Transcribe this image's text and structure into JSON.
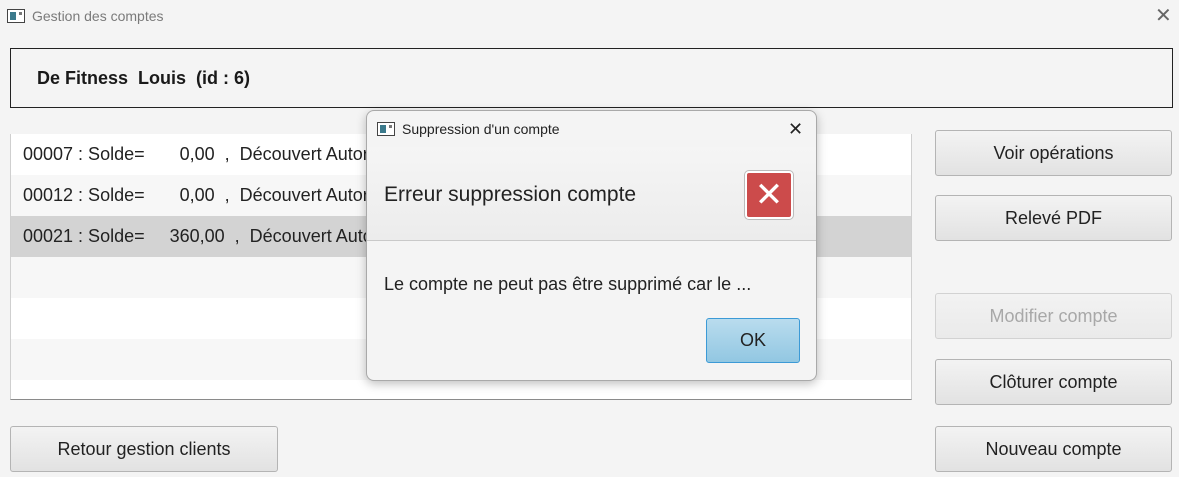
{
  "window": {
    "title": "Gestion des comptes",
    "close_glyph": "✕"
  },
  "client": {
    "header": "De Fitness  Louis  (id : 6)"
  },
  "accounts": [
    {
      "label": "00007 : Solde=       0,00  ,  Découvert Autorisé = "
    },
    {
      "label": "00012 : Solde=       0,00  ,  Découvert Autorisé = "
    },
    {
      "label": "00021 : Solde=     360,00  ,  Découvert Autorisé = "
    }
  ],
  "actions": {
    "view_operations": "Voir opérations",
    "pdf_statement": "Relevé PDF",
    "edit_account": "Modifier compte",
    "close_account": "Clôturer compte",
    "new_account": "Nouveau compte",
    "back_clients": "Retour gestion clients"
  },
  "dialog": {
    "title": "Suppression d'un compte",
    "heading": "Erreur suppression compte",
    "message": "Le compte ne peut pas être supprimé car le ...",
    "ok_label": "OK",
    "close_glyph": "✕",
    "error_glyph": "✕"
  },
  "colors": {
    "error_red": "#cc4b4b",
    "ok_blue": "#92c7e2",
    "selected_row": "#d3d3d3"
  },
  "icons": [
    "app-icon",
    "close-icon",
    "error-icon"
  ]
}
